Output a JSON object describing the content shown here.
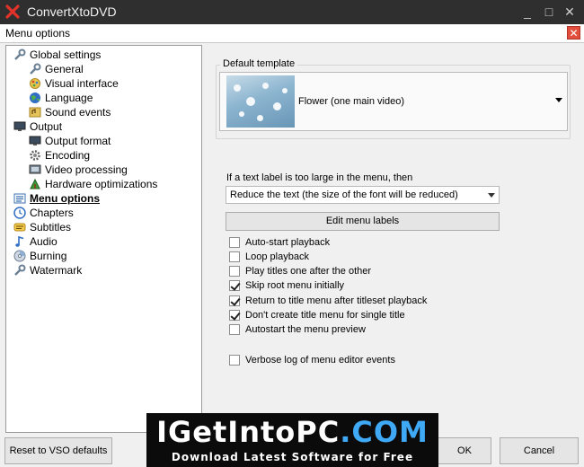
{
  "app": {
    "title": "ConvertXtoDVD",
    "logo_icon": "convertx-logo-icon",
    "minimize": "_",
    "maximize": "□",
    "close": "✕"
  },
  "dialog": {
    "title": "Menu options",
    "close_icon": "close-icon",
    "close_color": "#e24d3c"
  },
  "tree": {
    "items": [
      {
        "label": "Global settings",
        "icon": "global-settings-icon"
      },
      {
        "label": "General",
        "icon": "general-icon"
      },
      {
        "label": "Visual interface",
        "icon": "visual-interface-icon"
      },
      {
        "label": "Language",
        "icon": "language-globe-icon"
      },
      {
        "label": "Sound events",
        "icon": "sound-events-icon"
      },
      {
        "label": "Output",
        "icon": "output-monitor-icon"
      },
      {
        "label": "Output format",
        "icon": "output-format-icon"
      },
      {
        "label": "Encoding",
        "icon": "encoding-gear-icon"
      },
      {
        "label": "Video processing",
        "icon": "video-processing-icon"
      },
      {
        "label": "Hardware optimizations",
        "icon": "hardware-optimizations-icon"
      },
      {
        "label": "Menu options",
        "icon": "menu-options-icon",
        "selected": true
      },
      {
        "label": "Chapters",
        "icon": "chapters-clock-icon"
      },
      {
        "label": "Subtitles",
        "icon": "subtitles-icon"
      },
      {
        "label": "Audio",
        "icon": "audio-note-icon"
      },
      {
        "label": "Burning",
        "icon": "burning-disc-icon"
      },
      {
        "label": "Watermark",
        "icon": "watermark-icon"
      }
    ]
  },
  "template": {
    "group_title": "Default template",
    "selected": "Flower (one main video)"
  },
  "label_size": {
    "question": "If a text label is too large in the menu, then",
    "selected": "Reduce the text (the size of the font will be reduced)"
  },
  "edit_labels_button": "Edit menu labels",
  "checkboxes": [
    {
      "label": "Auto-start playback",
      "checked": false
    },
    {
      "label": "Loop playback",
      "checked": false
    },
    {
      "label": "Play titles one after the other",
      "checked": false
    },
    {
      "label": "Skip root menu initially",
      "checked": true
    },
    {
      "label": "Return to title menu after titleset playback",
      "checked": true
    },
    {
      "label": "Don't create title menu for single title",
      "checked": true
    },
    {
      "label": "Autostart the menu preview",
      "checked": false
    },
    {
      "label": "Verbose log of menu editor events",
      "checked": false
    }
  ],
  "footer": {
    "reset_button": "Reset to VSO defaults",
    "ok_button": "OK",
    "cancel_button": "Cancel"
  },
  "watermark": {
    "line1_a": "IGetIntoPC",
    "line1_dot": ".",
    "line1_b": "COM",
    "line2": "Download Latest Software for Free",
    "accent": "#3fa9f5"
  }
}
